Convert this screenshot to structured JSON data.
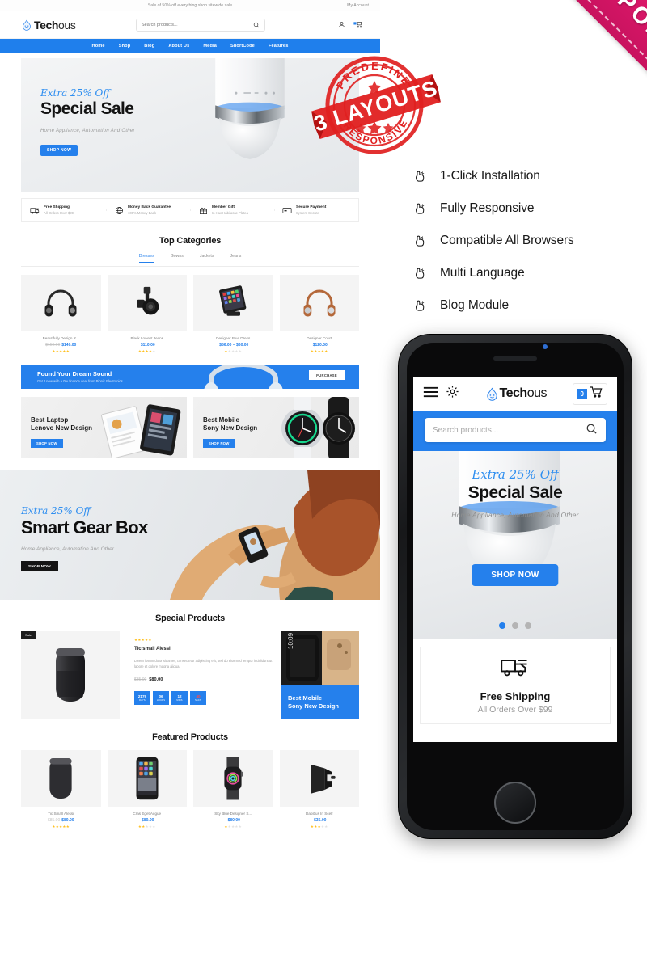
{
  "product_preview": {
    "topbar": {
      "promo_text": "Sale of 50% off everything shop sitewide sale",
      "account_label": "My Account"
    },
    "header": {
      "logo_bold": "Tech",
      "logo_light": "ous",
      "search_placeholder": "Search products...",
      "search_icon": "search-icon",
      "account_icon": "user-icon",
      "cart_icon": "cart-icon"
    },
    "nav": [
      "Home",
      "Shop",
      "Blog",
      "About Us",
      "Media",
      "ShortCode",
      "Features"
    ],
    "hero": {
      "eyebrow": "Extra 25% Off",
      "title": "Special Sale",
      "subtitle": "Home Appliance, Automation And Other",
      "button": "SHOP NOW"
    },
    "services": [
      {
        "title": "Free Shipping",
        "sub": "All Orders Over $99",
        "icon": "truck-icon"
      },
      {
        "title": "Money Back Guarantee",
        "sub": "100% Money Back",
        "icon": "globe-icon"
      },
      {
        "title": "Member Gift",
        "sub": "In Hac Habitasse Platea",
        "icon": "gift-icon"
      },
      {
        "title": "Secure Payment",
        "sub": "System Secure",
        "icon": "card-icon"
      }
    ],
    "top_categories": {
      "heading": "Top Categories",
      "tabs": [
        "Dresses",
        "Gowns",
        "Jackets",
        "Jeans"
      ],
      "active_tab": "Dresses",
      "products": [
        {
          "name": "Beautifully Design R...",
          "old_price": "$150.00",
          "price": "$140.00",
          "stars": 5,
          "image": "headphones-black"
        },
        {
          "name": "Black Lowest Jeans",
          "old_price": "",
          "price": "$110.00",
          "stars": 4,
          "image": "camera-gimbal"
        },
        {
          "name": "Designer Blue Dress",
          "old_price": "",
          "price": "$56.00 – $60.00",
          "stars": 1,
          "image": "tablet-stand"
        },
        {
          "name": "Designer Court",
          "old_price": "",
          "price": "$120.00",
          "stars": 5,
          "image": "headphones-tan"
        }
      ]
    },
    "wide_promo": {
      "title": "Found Your Dream Sound",
      "subtitle": "Get it now with a 0% finance deal from Bionic Electronics.",
      "button": "PURCHASE"
    },
    "promo_cards": [
      {
        "line1": "Best Laptop",
        "line2": "Lenovo New Design",
        "button": "SHOP NOW"
      },
      {
        "line1": "Best Mobile",
        "line2": "Sony New Design",
        "button": "SHOP NOW"
      }
    ],
    "gear_banner": {
      "eyebrow": "Extra 25% Off",
      "title": "Smart Gear Box",
      "subtitle": "Home Appliance, Automation And Other",
      "button": "SHOP NOW"
    },
    "special_products": {
      "heading": "Special Products",
      "badge": "Sale",
      "stars": 5,
      "name": "Tic small Alessi",
      "description": "Lorem ipsum dolor sit amet, consectetur adipiscing elit, sed do eiusmod tempor incididunt ut labore et dolore magna aliqua.",
      "old_price": "$85.00",
      "price": "$80.00",
      "countdown": [
        {
          "value": "2179",
          "label": "DAYS"
        },
        {
          "value": "06",
          "label": "HOURS"
        },
        {
          "value": "12",
          "label": "MINS"
        },
        {
          "value": "40",
          "label": "SECS"
        }
      ],
      "side_card": {
        "line1": "Best Mobile",
        "line2": "Sony New Design"
      }
    },
    "featured_products": {
      "heading": "Featured Products",
      "products": [
        {
          "name": "Tic Small Alessi",
          "old_price": "$85.00",
          "price": "$80.00",
          "stars": 5,
          "image": "speaker"
        },
        {
          "name": "Cras Eget Augue",
          "old_price": "",
          "price": "$80.00",
          "stars": 2,
          "image": "iphone"
        },
        {
          "name": "Sky Blue Designer S...",
          "old_price": "",
          "price": "$80.00",
          "stars": 1,
          "image": "apple-watch"
        },
        {
          "name": "Dapibus In Scelf",
          "old_price": "",
          "price": "$35.00",
          "stars": 3,
          "image": "phone-holder"
        }
      ]
    }
  },
  "ribbon": {
    "label": "RESPONSIVE",
    "color": "#e21a6e"
  },
  "stamp": {
    "top_text": "PREDEFINE",
    "banner_text": "3 LAYOUTS",
    "bottom_text": "RESPONSIVE",
    "color": "#e02020"
  },
  "features": [
    {
      "label": "1-Click Installation",
      "icon": "hand-point-icon"
    },
    {
      "label": "Fully Responsive",
      "icon": "hand-point-icon"
    },
    {
      "label": "Compatible All Browsers",
      "icon": "hand-point-icon"
    },
    {
      "label": "Multi Language",
      "icon": "hand-point-icon"
    },
    {
      "label": "Blog Module",
      "icon": "hand-point-icon"
    }
  ],
  "phone_preview": {
    "header": {
      "menu_icon": "hamburger-icon",
      "settings_icon": "gear-icon",
      "logo_bold": "Tech",
      "logo_light": "ous",
      "cart_count": "0",
      "cart_icon": "cart-icon"
    },
    "search_placeholder": "Search products...",
    "search_icon": "search-icon",
    "hero": {
      "eyebrow": "Extra 25% Off",
      "title": "Special Sale",
      "subtitle": "Home Appliance, Automation And Other",
      "button": "SHOP NOW",
      "dots": 3,
      "active_dot": 1
    },
    "shipping": {
      "icon": "truck-icon",
      "title": "Free Shipping",
      "subtitle": "All Orders Over $99"
    }
  },
  "accent_colors": {
    "brand_blue": "#2580ec",
    "nav_blue": "#1f7fec",
    "star_gold": "#ffc01f",
    "ribbon_pink": "#e21a6e",
    "stamp_red": "#e02020"
  }
}
